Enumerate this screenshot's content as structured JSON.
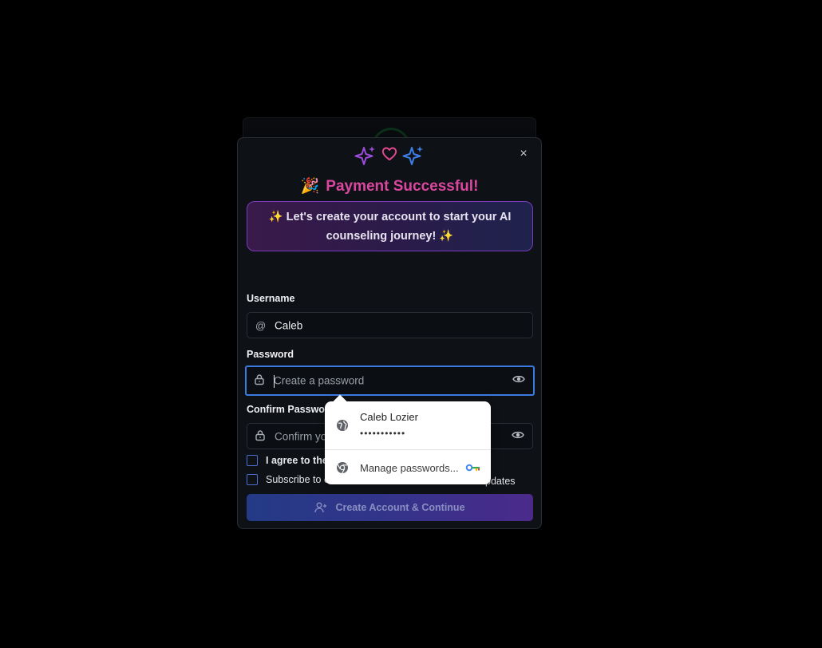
{
  "modal": {
    "close_label": "×",
    "title_emoji": "🎉",
    "title": "Payment Successful!",
    "banner_text": "✨ Let's create your account to start your AI counseling journey! ✨",
    "username": {
      "label": "Username",
      "value": "Caleb",
      "icon": "at-icon"
    },
    "password": {
      "label": "Password",
      "placeholder": "Create a password",
      "icon": "lock-icon"
    },
    "confirm_password": {
      "label": "Confirm Password",
      "placeholder": "Confirm yo",
      "icon": "lock-icon"
    },
    "terms_label": "I agree to the",
    "subscribe_label": "Subscribe to c",
    "subscribe_label_tail": "pdates",
    "submit_label": "Create Account & Continue"
  },
  "password_popup": {
    "saved_user": "Caleb Lozier",
    "saved_password_mask": "•••••••••••",
    "manage_label": "Manage passwords..."
  },
  "colors": {
    "title": "#d9479e",
    "focus_border": "#3b7be0",
    "banner_border": "#7b3bbf",
    "sparkle_purple": "#9b4ddb",
    "sparkle_blue": "#3f7fe8",
    "heart": "#e0488f"
  }
}
